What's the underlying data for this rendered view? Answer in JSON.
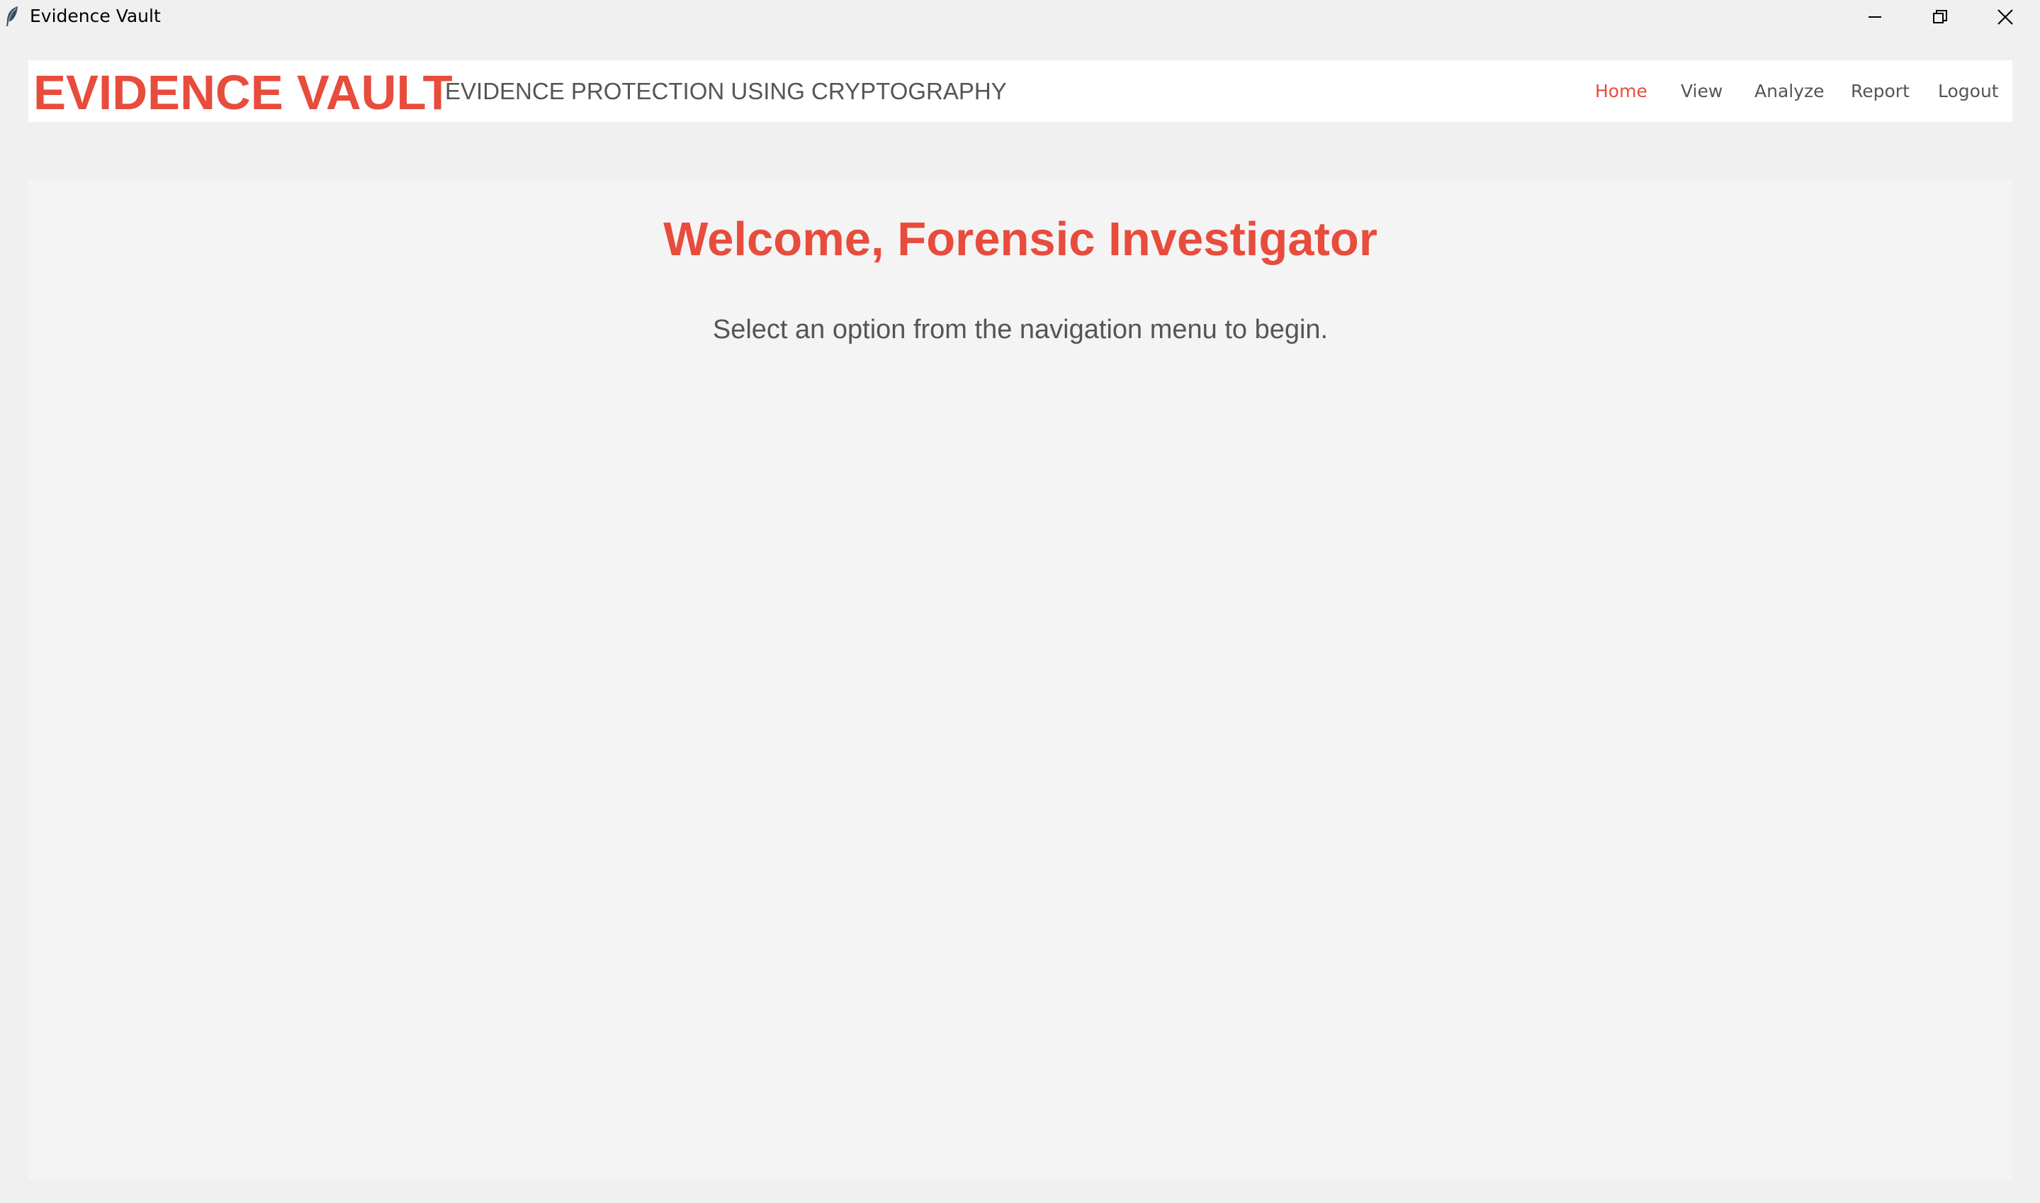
{
  "window": {
    "title": "Evidence Vault",
    "icon": "feather-icon"
  },
  "header": {
    "brand": "EVIDENCE VAULT",
    "tagline": "EVIDENCE PROTECTION USING CRYPTOGRAPHY",
    "nav": [
      {
        "label": "Home",
        "active": true
      },
      {
        "label": "View",
        "active": false
      },
      {
        "label": "Analyze",
        "active": false
      },
      {
        "label": "Report",
        "active": false
      },
      {
        "label": "Logout",
        "active": false
      }
    ]
  },
  "main": {
    "welcome": "Welcome, Forensic Investigator",
    "instruction": "Select an option from the navigation menu to begin."
  },
  "colors": {
    "accent": "#e74c3c",
    "text_muted": "#555555",
    "header_bg": "#ffffff",
    "panel_bg": "#f4f4f4",
    "window_bg": "#f0f0f0"
  }
}
